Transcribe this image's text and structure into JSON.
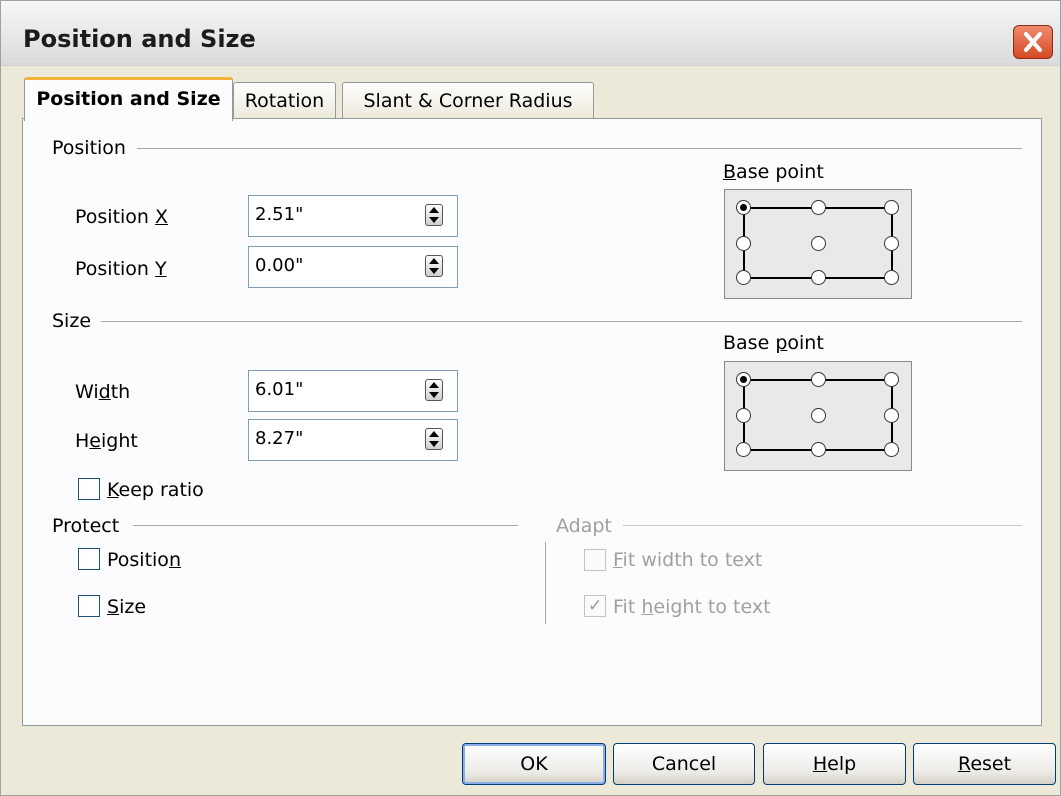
{
  "window": {
    "title": "Position and Size"
  },
  "tabs": [
    {
      "label": "Position and Size",
      "active": true
    },
    {
      "label": "Rotation",
      "active": false
    },
    {
      "label": "Slant & Corner Radius",
      "active": false
    }
  ],
  "position": {
    "heading": "Position",
    "x_label_pre": "Position ",
    "x_label_key": "X",
    "x_value": "2.51\"",
    "y_label_pre": "Position ",
    "y_label_key": "Y",
    "y_value": "0.00\"",
    "base_point_pre": "",
    "base_point_key": "B",
    "base_point_post": "ase point",
    "base_point_selected": "top-left"
  },
  "size": {
    "heading": "Size",
    "width_pre": "Wi",
    "width_key": "d",
    "width_post": "th",
    "width_value": "6.01\"",
    "height_pre": "H",
    "height_key": "e",
    "height_post": "ight",
    "height_value": "8.27\"",
    "keep_ratio_key": "K",
    "keep_ratio_post": "eep ratio",
    "keep_ratio_checked": false,
    "base_point_pre": "Base ",
    "base_point_key": "p",
    "base_point_post": "oint",
    "base_point_selected": "top-left"
  },
  "protect": {
    "heading": "Protect",
    "position_pre": "Positio",
    "position_key": "n",
    "position_checked": false,
    "size_key": "S",
    "size_post": "ize",
    "size_checked": false
  },
  "adapt": {
    "heading": "Adapt",
    "fit_width_key": "F",
    "fit_width_post": "it width to text",
    "fit_width_checked": false,
    "fit_height_pre": "Fit ",
    "fit_height_key": "h",
    "fit_height_post": "eight to text",
    "fit_height_checked": true,
    "enabled": false
  },
  "buttons": {
    "ok": "OK",
    "cancel": "Cancel",
    "help_key": "H",
    "help_post": "elp",
    "reset_key": "R",
    "reset_post": "eset"
  },
  "icons": {
    "close": "close-icon",
    "spin": "spin-button-icon",
    "check": "✓"
  }
}
